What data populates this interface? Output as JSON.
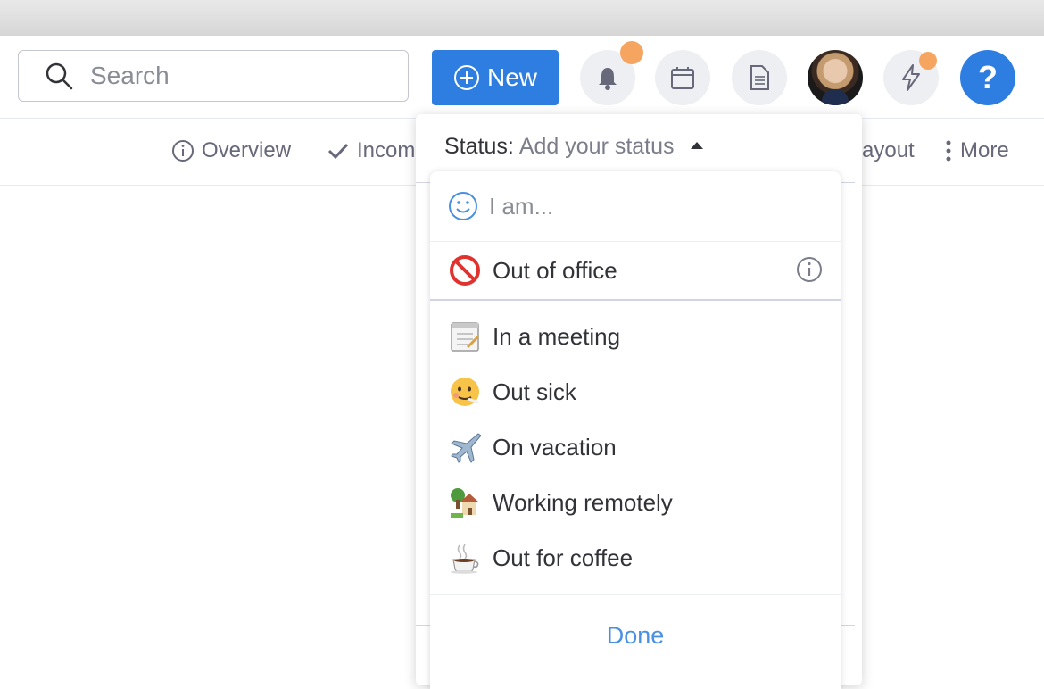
{
  "header": {
    "search": {
      "placeholder": "Search",
      "icon": "search-icon"
    },
    "new_button": {
      "label": "New",
      "icon": "plus-circle-icon"
    },
    "icons": [
      "bell-icon",
      "calendar-icon",
      "document-icon",
      "avatar",
      "lightning-icon",
      "help-icon"
    ],
    "help_label": "?",
    "accent_color": "#2d7ee0",
    "badge_color": "#f6a560"
  },
  "subnav": {
    "overview": "Overview",
    "incoming": "Incom",
    "layout": "ayout",
    "more": "More"
  },
  "status_dropdown": {
    "label": "Status:",
    "placeholder": "Add your status",
    "input_placeholder": "I am...",
    "out_of_office": {
      "emoji": "🚫",
      "label": "Out of office"
    },
    "options": [
      {
        "emoji": "🗓️",
        "label": "In a meeting"
      },
      {
        "emoji": "🤒",
        "label": "Out sick"
      },
      {
        "emoji": "✈️",
        "label": "On vacation"
      },
      {
        "emoji": "🏡",
        "label": "Working remotely"
      },
      {
        "emoji": "☕",
        "label": "Out for coffee"
      }
    ],
    "done_label": "Done",
    "done_color": "#4a90e2"
  }
}
